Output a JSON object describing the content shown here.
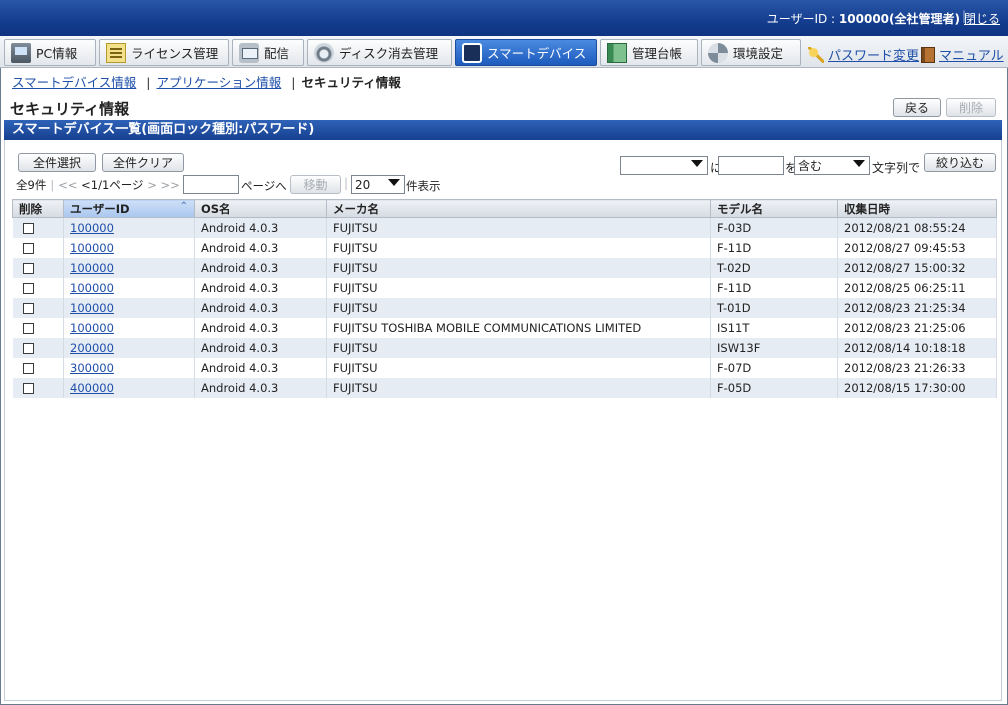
{
  "topbar": {
    "user_label": "ユーザーID : ",
    "user_value": "100000(全社管理者)",
    "separator": "|",
    "close_label": "閉じる"
  },
  "nav": {
    "tabs": [
      {
        "label": "PC情報",
        "icon": "pc-icon"
      },
      {
        "label": "ライセンス管理",
        "icon": "license-icon"
      },
      {
        "label": "配信",
        "icon": "distribution-icon"
      },
      {
        "label": "ディスク消去管理",
        "icon": "disk-erase-icon"
      },
      {
        "label": "スマートデバイス",
        "icon": "smart-device-icon"
      },
      {
        "label": "管理台帳",
        "icon": "ledger-icon"
      },
      {
        "label": "環境設定",
        "icon": "settings-icon"
      }
    ],
    "password_link": "パスワード変更",
    "manual_link": "マニュアル"
  },
  "breadcrumb": {
    "item1": "スマートデバイス情報",
    "item2": "アプリケーション情報",
    "current": "セキュリティ情報",
    "sep": "|"
  },
  "page": {
    "title": "セキュリティ情報",
    "back_button": "戻る",
    "delete_button": "削除"
  },
  "section": {
    "title": "スマートデバイス一覧(画面ロック種別:パスワード)"
  },
  "controls": {
    "select_all": "全件選択",
    "clear_all": "全件クリア",
    "filter_field_value": "",
    "filter_ni": "に",
    "filter_text_value": "",
    "filter_wo": "を",
    "filter_op": "含む",
    "filter_suffix": "文字列で",
    "filter_button": "絞り込む",
    "total": "全9件",
    "first": "<<",
    "page_info": "<1/1ページ",
    "next": ">",
    "last": ">>",
    "vbar": "|",
    "page_input": "",
    "page_to": "ページへ",
    "move_button": "移動",
    "page_size": "20",
    "page_size_suffix": "件表示"
  },
  "table": {
    "headers": [
      "削除",
      "ユーザーID",
      "OS名",
      "メーカ名",
      "モデル名",
      "収集日時"
    ],
    "rows": [
      {
        "user": "100000",
        "os": "Android 4.0.3",
        "maker": "FUJITSU",
        "model": "F-03D",
        "date": "2012/08/21 08:55:24"
      },
      {
        "user": "100000",
        "os": "Android 4.0.3",
        "maker": "FUJITSU",
        "model": "F-11D",
        "date": "2012/08/27 09:45:53"
      },
      {
        "user": "100000",
        "os": "Android 4.0.3",
        "maker": "FUJITSU",
        "model": "T-02D",
        "date": "2012/08/27 15:00:32"
      },
      {
        "user": "100000",
        "os": "Android 4.0.3",
        "maker": "FUJITSU",
        "model": "F-11D",
        "date": "2012/08/25 06:25:11"
      },
      {
        "user": "100000",
        "os": "Android 4.0.3",
        "maker": "FUJITSU",
        "model": "T-01D",
        "date": "2012/08/23 21:25:34"
      },
      {
        "user": "100000",
        "os": "Android 4.0.3",
        "maker": "FUJITSU TOSHIBA MOBILE COMMUNICATIONS LIMITED",
        "model": "IS11T",
        "date": "2012/08/23 21:25:06"
      },
      {
        "user": "200000",
        "os": "Android 4.0.3",
        "maker": "FUJITSU",
        "model": "ISW13F",
        "date": "2012/08/14 10:18:18"
      },
      {
        "user": "300000",
        "os": "Android 4.0.3",
        "maker": "FUJITSU",
        "model": "F-07D",
        "date": "2012/08/23 21:26:33"
      },
      {
        "user": "400000",
        "os": "Android 4.0.3",
        "maker": "FUJITSU",
        "model": "F-05D",
        "date": "2012/08/15 17:30:00"
      }
    ]
  },
  "colors": {
    "header_blue": "#143d8f",
    "active_tab": "#1d5bbd",
    "row_alt": "#e6ecf4",
    "link": "#1f4fa8"
  }
}
